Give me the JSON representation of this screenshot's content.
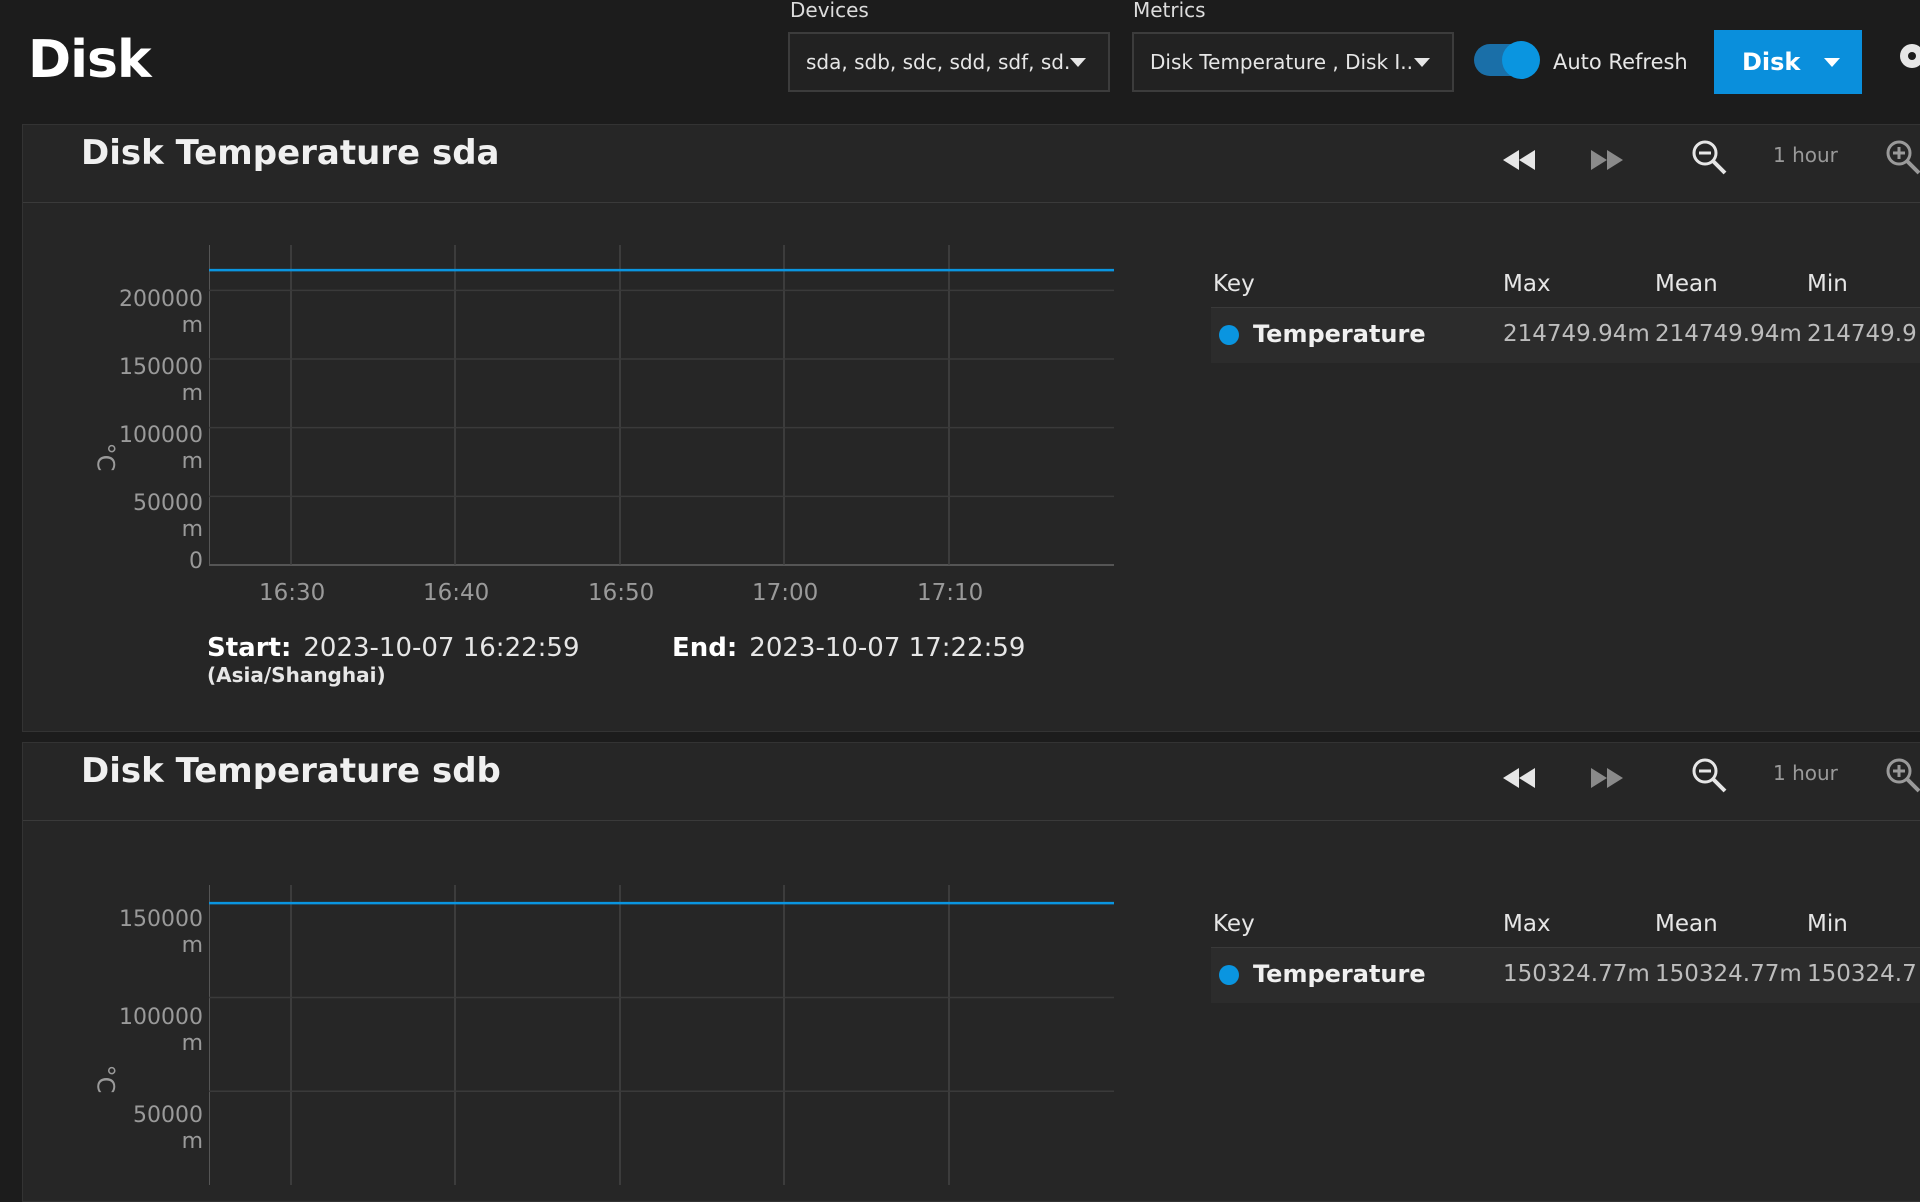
{
  "page": {
    "title": "Disk"
  },
  "toolbar": {
    "devices_label": "Devices",
    "devices_value": "sda, sdb, sdc, sdd, sdf, sd...",
    "metrics_label": "Metrics",
    "metrics_value": "Disk Temperature , Disk I...",
    "auto_refresh_label": "Auto Refresh",
    "auto_refresh_on": true,
    "disk_button_label": "Disk"
  },
  "colors": {
    "accent": "#0a95e0",
    "series": "#0a95e0"
  },
  "icons": [
    "chevron-down-icon",
    "gear-icon",
    "rewind-icon",
    "fast-forward-icon",
    "zoom-out-icon",
    "zoom-in-icon"
  ],
  "charts": [
    {
      "title": "Disk Temperature sda",
      "zoom_label": "1 hour",
      "y_unit": "°C",
      "y_ticks": [
        "200000\nm",
        "150000\nm",
        "100000\nm",
        "50000\nm",
        "0"
      ],
      "x_ticks": [
        "16:30",
        "16:40",
        "16:50",
        "17:00",
        "17:10"
      ],
      "start_label": "Start:",
      "start_value": "2023-10-07 16:22:59",
      "timezone": "(Asia/Shanghai)",
      "end_label": "End:",
      "end_value": "2023-10-07 17:22:59",
      "legend": {
        "headers": [
          "Key",
          "Max",
          "Mean",
          "Min"
        ],
        "rows": [
          {
            "name": "Temperature",
            "max": "214749.94m",
            "mean": "214749.94m",
            "min": "214749.9"
          }
        ]
      }
    },
    {
      "title": "Disk Temperature sdb",
      "zoom_label": "1 hour",
      "y_unit": "°C",
      "y_ticks": [
        "150000\nm",
        "100000\nm",
        "50000\nm"
      ],
      "x_ticks": [],
      "legend": {
        "headers": [
          "Key",
          "Max",
          "Mean",
          "Min"
        ],
        "rows": [
          {
            "name": "Temperature",
            "max": "150324.77m",
            "mean": "150324.77m",
            "min": "150324.7"
          }
        ]
      }
    }
  ],
  "chart_data": [
    {
      "type": "line",
      "title": "Disk Temperature sda",
      "ylabel": "°C",
      "x": [
        "16:22:59",
        "17:22:59"
      ],
      "series": [
        {
          "name": "Temperature",
          "values": [
            214749.94,
            214749.94
          ]
        }
      ],
      "ylim": [
        0,
        233000
      ],
      "x_ticks": [
        "16:30",
        "16:40",
        "16:50",
        "17:00",
        "17:10"
      ],
      "grid": true
    },
    {
      "type": "line",
      "title": "Disk Temperature sdb",
      "ylabel": "°C",
      "x": [
        "16:22:59",
        "17:22:59"
      ],
      "series": [
        {
          "name": "Temperature",
          "values": [
            150324.77,
            150324.77
          ]
        }
      ],
      "ylim": [
        0,
        160000
      ],
      "grid": true
    }
  ]
}
